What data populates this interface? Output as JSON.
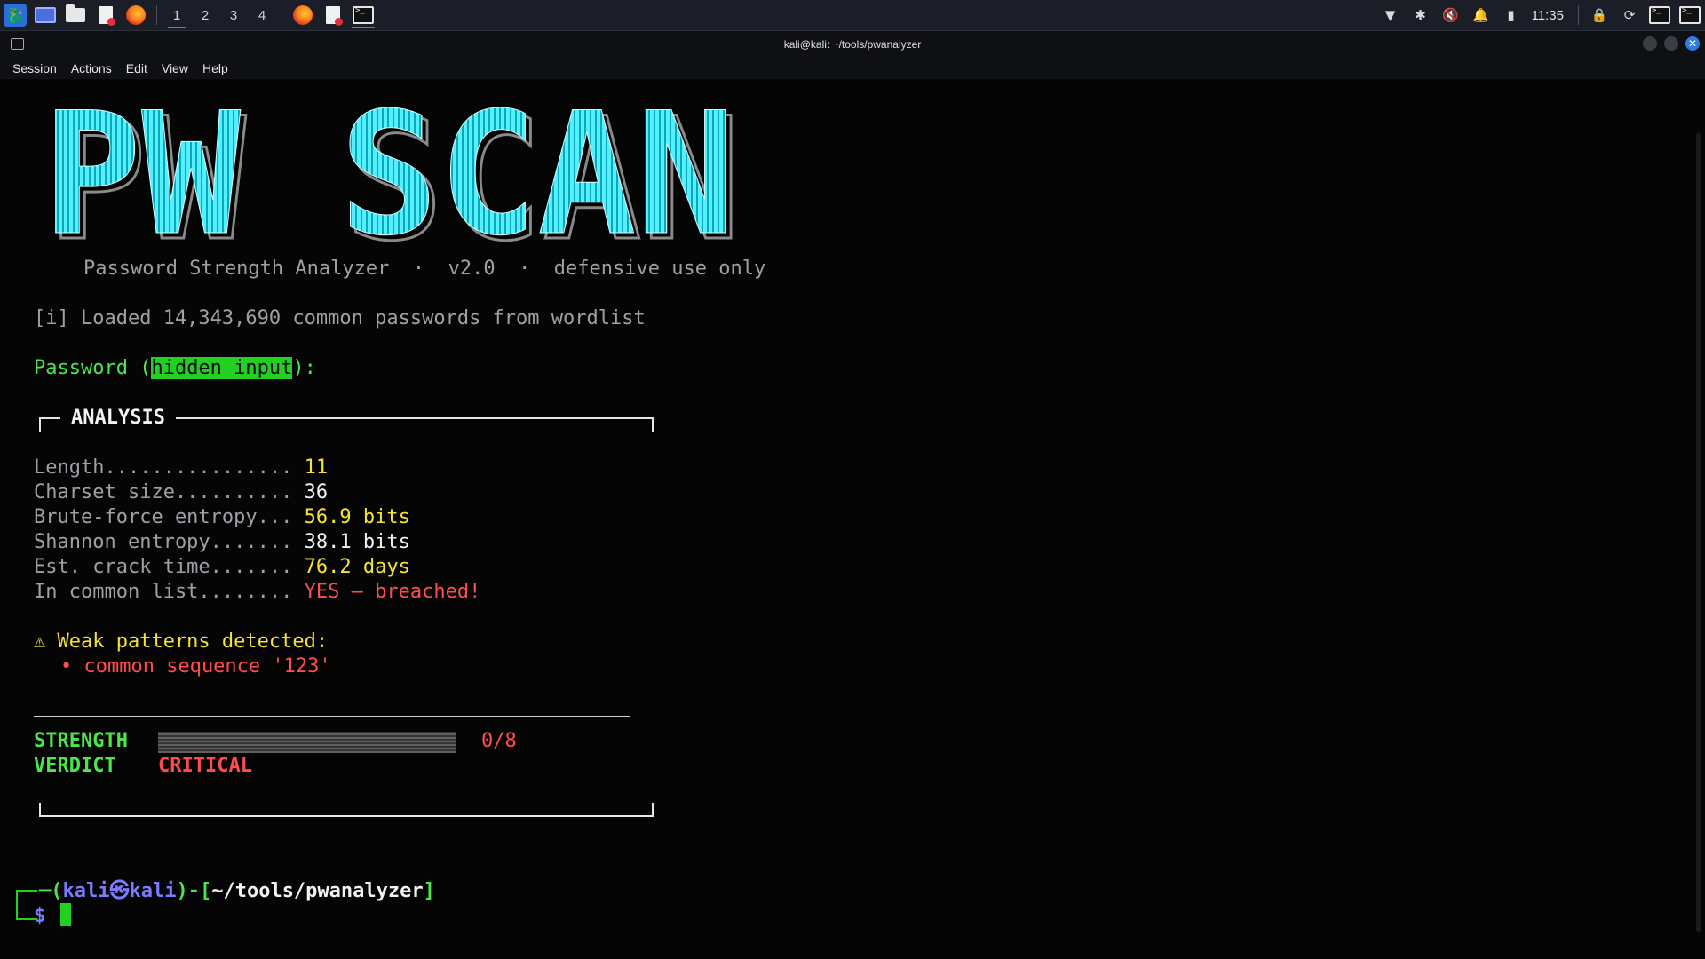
{
  "panel": {
    "workspaces": [
      "1",
      "2",
      "3",
      "4"
    ],
    "active_workspace": "1",
    "clock": "11:35",
    "launchers": [
      "kali-menu-icon",
      "desktop-icon",
      "file-manager-icon",
      "text-editor-icon",
      "firefox-icon"
    ],
    "tasks": [
      "firefox-icon",
      "text-editor-icon",
      "terminal-icon"
    ],
    "tray": [
      "network-icon",
      "bluetooth-icon",
      "volume-muted-icon",
      "notifications-icon",
      "battery-icon",
      "lock-icon",
      "refresh-icon",
      "terminal-icon",
      "terminal-icon"
    ]
  },
  "window": {
    "title": "kali@kali: ~/tools/pwanalyzer",
    "menu": [
      "Session",
      "Actions",
      "Edit",
      "View",
      "Help"
    ]
  },
  "terminal": {
    "banner_text": "PW SCAN",
    "subtitle": "Password Strength Analyzer  ·  v2.0  ·  defensive use only",
    "loaded_line": "[i] Loaded 14,343,690 common passwords from wordlist",
    "password_prompt_pre": "Password (",
    "password_prompt_hl": "hidden input",
    "password_prompt_post": "):",
    "analysis_title": "ANALYSIS",
    "metrics": [
      {
        "label": "Length................",
        "value": "11",
        "color": "#f5e13b"
      },
      {
        "label": "Charset size..........",
        "value": "36",
        "color": "#f2f2f2"
      },
      {
        "label": "Brute-force entropy...",
        "value": "56.9 bits",
        "color": "#f5e13b"
      },
      {
        "label": "Shannon entropy.......",
        "value": "38.1 bits",
        "color": "#f2f2f2"
      },
      {
        "label": "Est. crack time.......",
        "value": "76.2 days",
        "color": "#f5e13b"
      },
      {
        "label": "In common list........",
        "value": "YES — breached!",
        "color": "#ff4d4d"
      }
    ],
    "weak_header": "⚠ Weak patterns detected:",
    "weak_items": [
      "• common sequence '123'"
    ],
    "strength_label": "STRENGTH",
    "strength_value": "0/8",
    "strength_fraction": 0,
    "verdict_label": "VERDICT",
    "verdict_value": "CRITICAL",
    "prompt_user": "kali㉿kali",
    "prompt_path": "~/tools/pwanalyzer",
    "prompt_symbol": "$"
  }
}
